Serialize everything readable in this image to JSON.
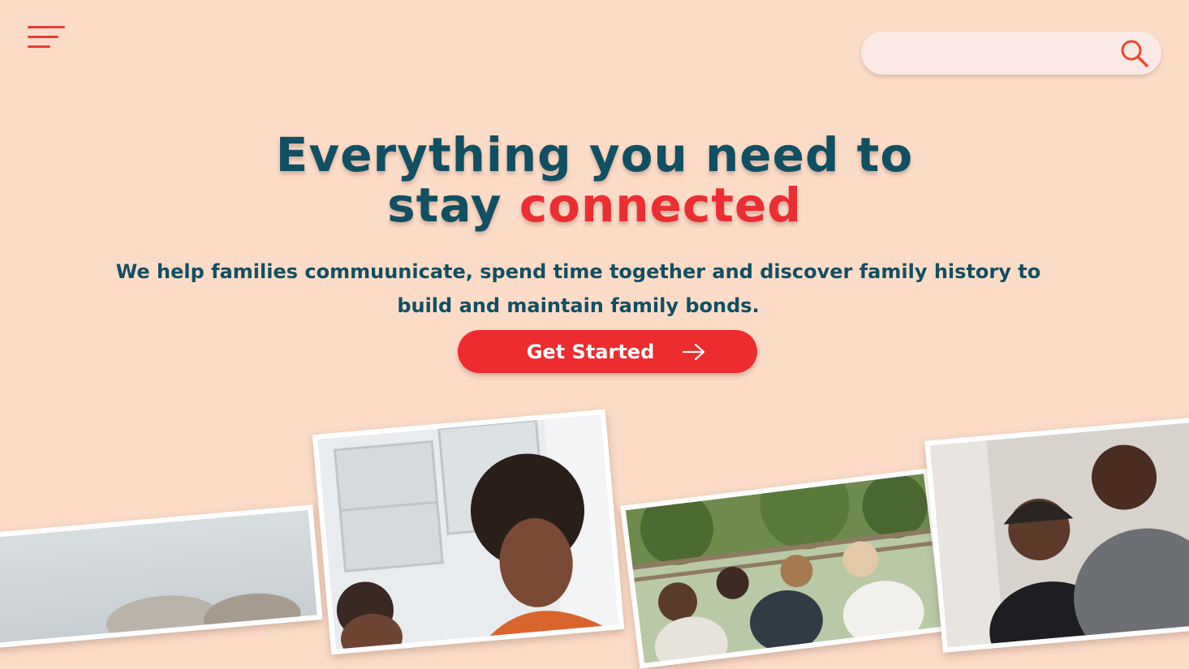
{
  "header": {
    "menu_icon": "hamburger-menu-icon",
    "search": {
      "value": "",
      "placeholder": "",
      "icon": "search-icon"
    }
  },
  "hero": {
    "headline_line1": "Everything you need to",
    "headline_prefix": "stay",
    "headline_accent": "connected",
    "subtitle": "We help families commuunicate, spend time together and discover family history to build and maintain family bonds.",
    "cta": {
      "label": "Get Started",
      "icon": "arrow-right-icon"
    }
  },
  "colors": {
    "background": "#FCDCC7",
    "primary_text": "#114F63",
    "accent": "#EC2C2E",
    "search_background": "#FBE9E6"
  },
  "gallery": {
    "photos": [
      "family-outdoors-photo",
      "kitchen-family-photo",
      "outdoor-toast-photo",
      "couple-photo"
    ]
  }
}
